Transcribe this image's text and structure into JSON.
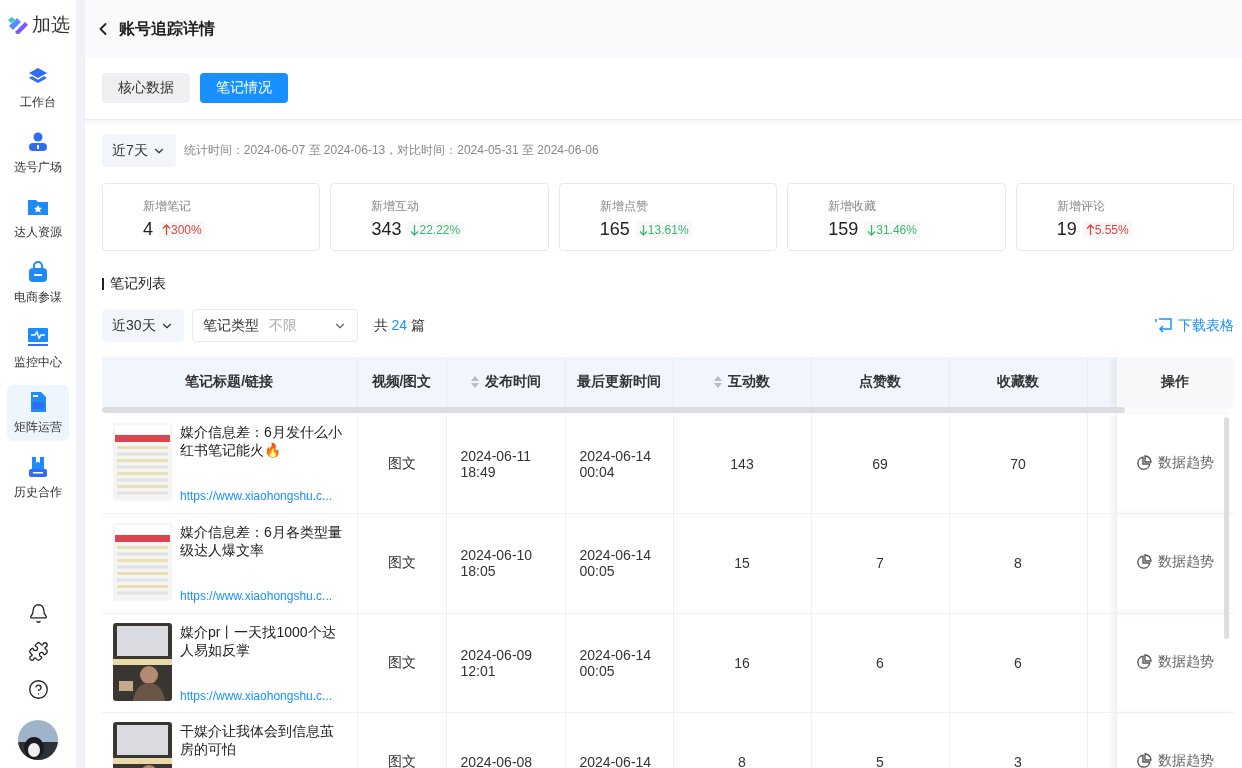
{
  "brand": {
    "name": "加选"
  },
  "sidebar": {
    "items": [
      {
        "label": "工作台",
        "selected": false
      },
      {
        "label": "选号广场",
        "selected": false
      },
      {
        "label": "达人资源",
        "selected": false
      },
      {
        "label": "电商参谋",
        "selected": false
      },
      {
        "label": "监控中心",
        "selected": false
      },
      {
        "label": "矩阵运营",
        "selected": true
      },
      {
        "label": "历史合作",
        "selected": false
      }
    ]
  },
  "header": {
    "title": "账号追踪详情"
  },
  "tabs": [
    {
      "label": "核心数据",
      "selected": false
    },
    {
      "label": "笔记情况",
      "selected": true
    }
  ],
  "summary": {
    "period": "近7天",
    "note": "统计时间：2024-06-07 至 2024-06-13，对比时间：2024-05-31 至 2024-06-06"
  },
  "metrics": [
    {
      "label": "新增笔记",
      "value": "4",
      "change": "300%",
      "kind": "up"
    },
    {
      "label": "新增互动",
      "value": "343",
      "change": "22.22%",
      "kind": "down"
    },
    {
      "label": "新增点赞",
      "value": "165",
      "change": "13.61%",
      "kind": "down"
    },
    {
      "label": "新增收藏",
      "value": "159",
      "change": "31.46%",
      "kind": "down"
    },
    {
      "label": "新增评论",
      "value": "19",
      "change": "5.55%",
      "kind": "up"
    }
  ],
  "notes": {
    "title": "笔记列表",
    "period": "近30天",
    "type_filter": {
      "label": "笔记类型",
      "placeholder": "不限"
    },
    "count": {
      "prefix": "共",
      "number": "24",
      "suffix": "篇"
    },
    "download": "下载表格"
  },
  "table": {
    "columns": [
      {
        "label": "笔记标题/链接",
        "sortable": false
      },
      {
        "label": "视频/图文",
        "sortable": false
      },
      {
        "label": "发布时间",
        "sortable": true
      },
      {
        "label": "最后更新时间",
        "sortable": false
      },
      {
        "label": "互动数",
        "sortable": true
      },
      {
        "label": "点赞数",
        "sortable": false
      },
      {
        "label": "收藏数",
        "sortable": false
      },
      {
        "label": "操作",
        "sortable": false
      }
    ],
    "rows": [
      {
        "title": "媒介信息差：6月发什么小红书笔记能火🔥",
        "link": "https://www.xiaohongshu.c...",
        "type": "图文",
        "published": [
          "2024-06-11",
          "18:49"
        ],
        "updated": [
          "2024-06-14",
          "00:04"
        ],
        "interactions": "143",
        "likes": "69",
        "favorites": "70",
        "action": "数据趋势"
      },
      {
        "title": "媒介信息差：6月各类型量级达人爆文率",
        "link": "https://www.xiaohongshu.c...",
        "type": "图文",
        "published": [
          "2024-06-10",
          "18:05"
        ],
        "updated": [
          "2024-06-14",
          "00:05"
        ],
        "interactions": "15",
        "likes": "7",
        "favorites": "8",
        "action": "数据趋势"
      },
      {
        "title": "媒介pr丨一天找1000个达人易如反掌",
        "link": "https://www.xiaohongshu.c...",
        "type": "图文",
        "published": [
          "2024-06-09",
          "12:01"
        ],
        "updated": [
          "2024-06-14",
          "00:05"
        ],
        "interactions": "16",
        "likes": "6",
        "favorites": "6",
        "action": "数据趋势"
      },
      {
        "title": "干媒介让我体会到信息茧房的可怕",
        "type": "图文",
        "published": [
          "2024-06-08"
        ],
        "updated": [
          "2024-06-14"
        ],
        "interactions": "8",
        "likes": "5",
        "favorites": "3",
        "action": "数据趋势"
      }
    ]
  }
}
